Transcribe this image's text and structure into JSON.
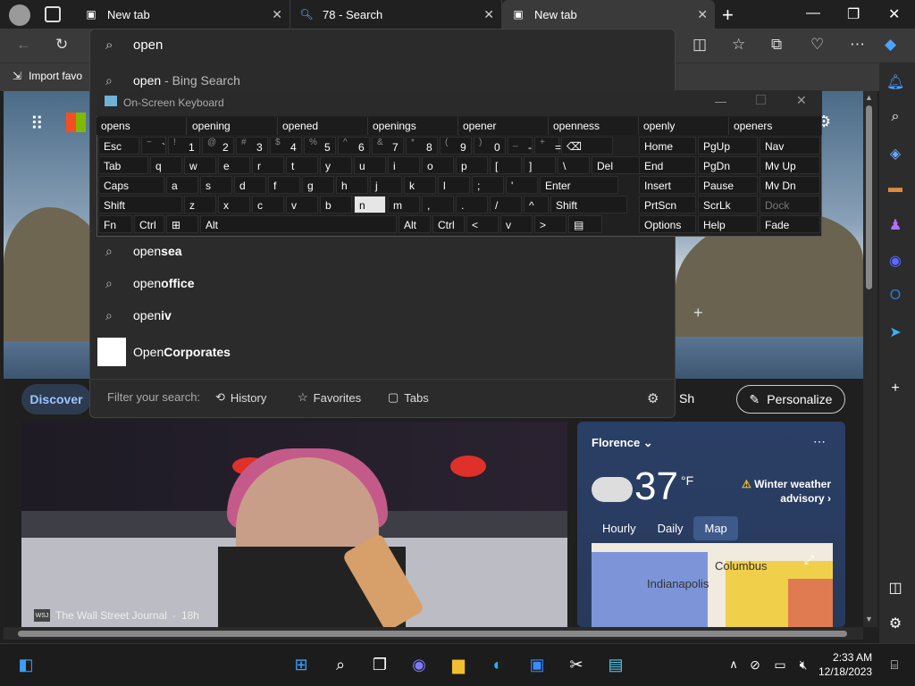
{
  "tabs": [
    {
      "label": "New tab",
      "icon": "newtab-icon"
    },
    {
      "label": "78 - Search",
      "icon": "search-icon"
    },
    {
      "label": "New tab",
      "icon": "newtab-icon"
    }
  ],
  "favbar": {
    "import_label": "Import favo"
  },
  "search": {
    "value": "open",
    "suggestions": [
      {
        "text": "open",
        "suffix": " - Bing Search"
      },
      {
        "prefix": "open",
        "bold": "sea"
      },
      {
        "prefix": "open",
        "bold": "office"
      },
      {
        "prefix": "open",
        "bold": "iv"
      },
      {
        "prefix": "Open",
        "bold": "Corporates"
      }
    ],
    "filter_label": "Filter your search:",
    "filters": [
      "History",
      "Favorites",
      "Tabs"
    ]
  },
  "osk": {
    "title": "On-Screen Keyboard",
    "predictions": [
      "opens",
      "opening",
      "opened",
      "openings",
      "opener",
      "openness",
      "openly",
      "openers"
    ],
    "row1": [
      {
        "main": "Esc"
      },
      {
        "shift": "~",
        "main": "`"
      },
      {
        "shift": "!",
        "main": "1"
      },
      {
        "shift": "@",
        "main": "2"
      },
      {
        "shift": "#",
        "main": "3"
      },
      {
        "shift": "$",
        "main": "4"
      },
      {
        "shift": "%",
        "main": "5"
      },
      {
        "shift": "^",
        "main": "6"
      },
      {
        "shift": "&",
        "main": "7"
      },
      {
        "shift": "*",
        "main": "8"
      },
      {
        "shift": "(",
        "main": "9"
      },
      {
        "shift": ")",
        "main": "0"
      },
      {
        "shift": "_",
        "main": "-"
      },
      {
        "shift": "+",
        "main": "="
      },
      {
        "main": "⌫"
      }
    ],
    "row2": [
      "Tab",
      "q",
      "w",
      "e",
      "r",
      "t",
      "y",
      "u",
      "i",
      "o",
      "p",
      "[",
      "]",
      "\\",
      "Del"
    ],
    "row3": [
      "Caps",
      "a",
      "s",
      "d",
      "f",
      "g",
      "h",
      "j",
      "k",
      "l",
      ";",
      "'",
      "Enter"
    ],
    "row4": [
      "Shift",
      "z",
      "x",
      "c",
      "v",
      "b",
      "n",
      "m",
      ",",
      ".",
      "/",
      "^",
      "Shift"
    ],
    "row5": [
      "Fn",
      "Ctrl",
      "⊞",
      "Alt",
      "Alt",
      "Ctrl",
      "<",
      "v",
      ">",
      "▤"
    ],
    "nav": [
      [
        "Home",
        "PgUp",
        "Nav"
      ],
      [
        "End",
        "PgDn",
        "Mv Up"
      ],
      [
        "Insert",
        "Pause",
        "Mv Dn"
      ],
      [
        "PrtScn",
        "ScrLk",
        "Dock"
      ],
      [
        "Options",
        "Help",
        "Fade"
      ]
    ]
  },
  "feed": {
    "discover": "Discover",
    "sh": "Sh",
    "personalize": "Personalize",
    "news_source": "The Wall Street Journal",
    "news_age": "18h",
    "wsj": "WSJ"
  },
  "weather": {
    "city": "Florence",
    "temp": "37",
    "unit": "°F",
    "advisory": "Winter weather advisory",
    "tabs": [
      "Hourly",
      "Daily",
      "Map"
    ],
    "map_label1": "Columbus",
    "map_label2": "Indianapolis"
  },
  "clock": {
    "time": "2:33 AM",
    "date": "12/18/2023"
  }
}
